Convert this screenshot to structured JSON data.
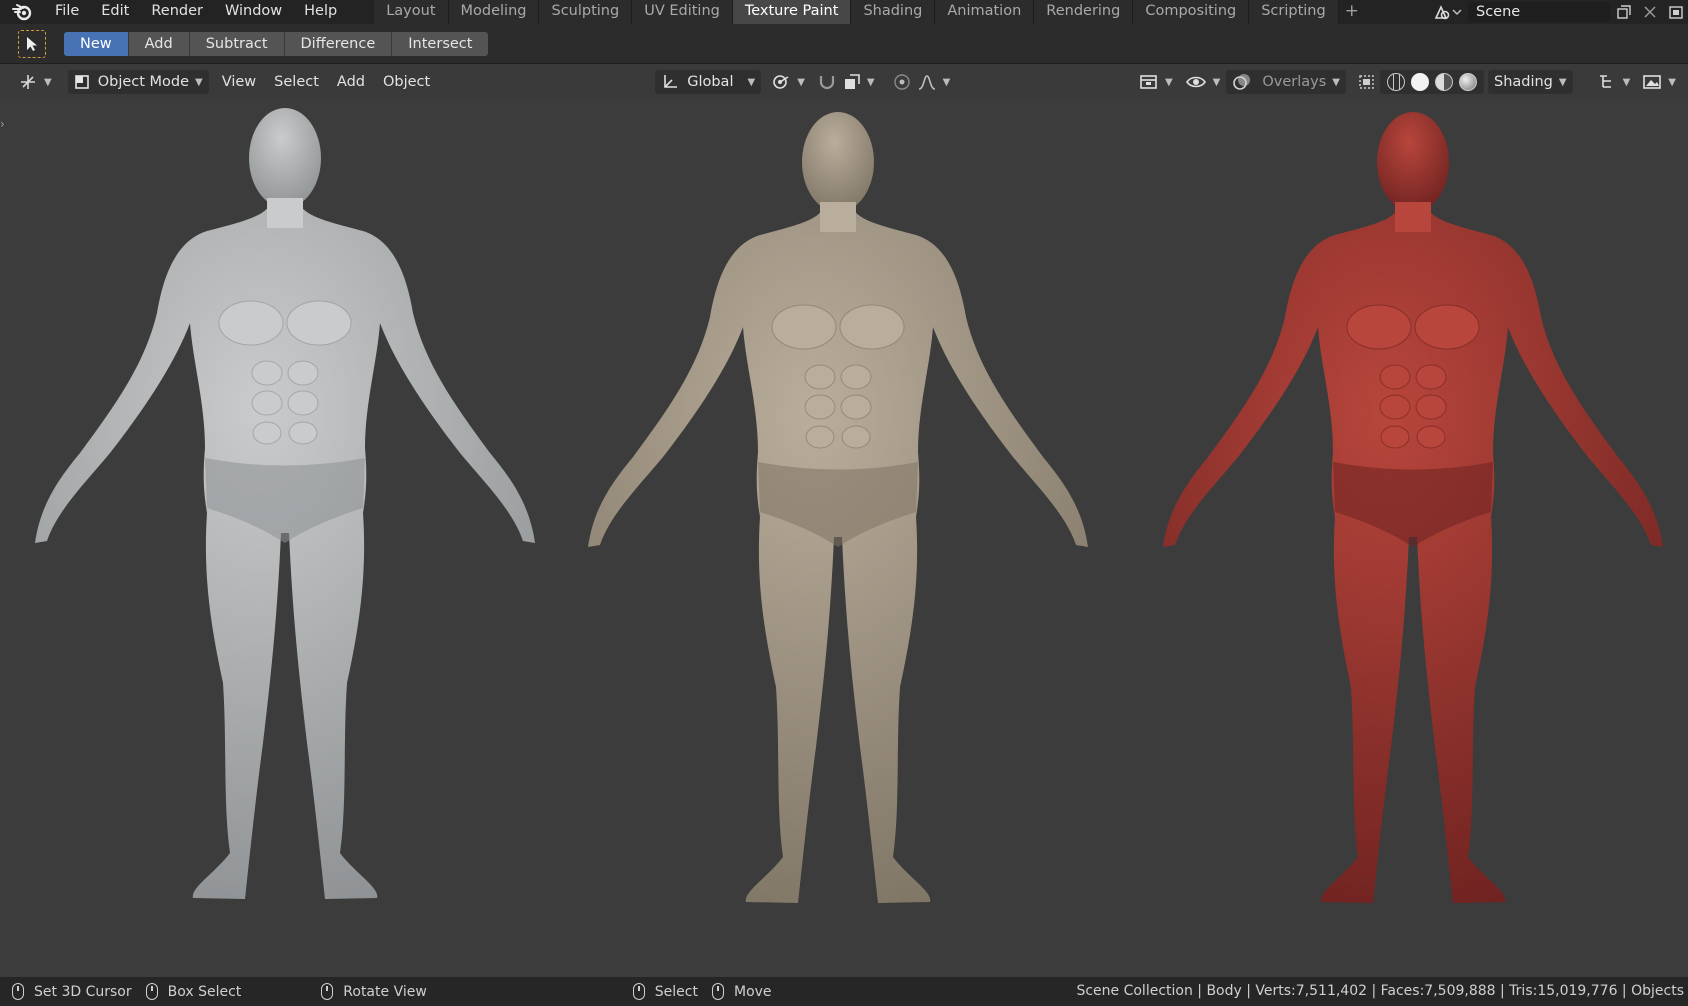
{
  "menu": [
    "File",
    "Edit",
    "Render",
    "Window",
    "Help"
  ],
  "workspaces": [
    "Layout",
    "Modeling",
    "Sculpting",
    "UV Editing",
    "Texture Paint",
    "Shading",
    "Animation",
    "Rendering",
    "Compositing",
    "Scripting"
  ],
  "active_workspace": "Texture Paint",
  "add_tab_glyph": "+",
  "scene_name": "Scene",
  "tool_modes": [
    "New",
    "Add",
    "Subtract",
    "Difference",
    "Intersect"
  ],
  "active_tool_mode": "New",
  "viewport_header": {
    "mode": "Object Mode",
    "menus": [
      "View",
      "Select",
      "Add",
      "Object"
    ],
    "orientation": "Global",
    "overlays": "Overlays",
    "shading": "Shading"
  },
  "figures": [
    {
      "material": "clay-grey",
      "skin_color": "#c9cbcc",
      "shadow_color": "#8e9193"
    },
    {
      "material": "clay-beige",
      "skin_color": "#b9ad9b",
      "shadow_color": "#7f7565"
    },
    {
      "material": "clay-red",
      "skin_color": "#b8463c",
      "shadow_color": "#6e2220"
    }
  ],
  "status": {
    "set_cursor": "Set 3D Cursor",
    "box_select": "Box Select",
    "rotate_view": "Rotate View",
    "select": "Select",
    "move": "Move",
    "stats": "Scene Collection | Body | Verts:7,511,402 | Faces:7,509,888 | Tris:15,019,776 | Objects"
  },
  "colors": {
    "accent": "#4772b3",
    "tool_outline": "#d39a3b",
    "background": "#3c3c3c"
  }
}
